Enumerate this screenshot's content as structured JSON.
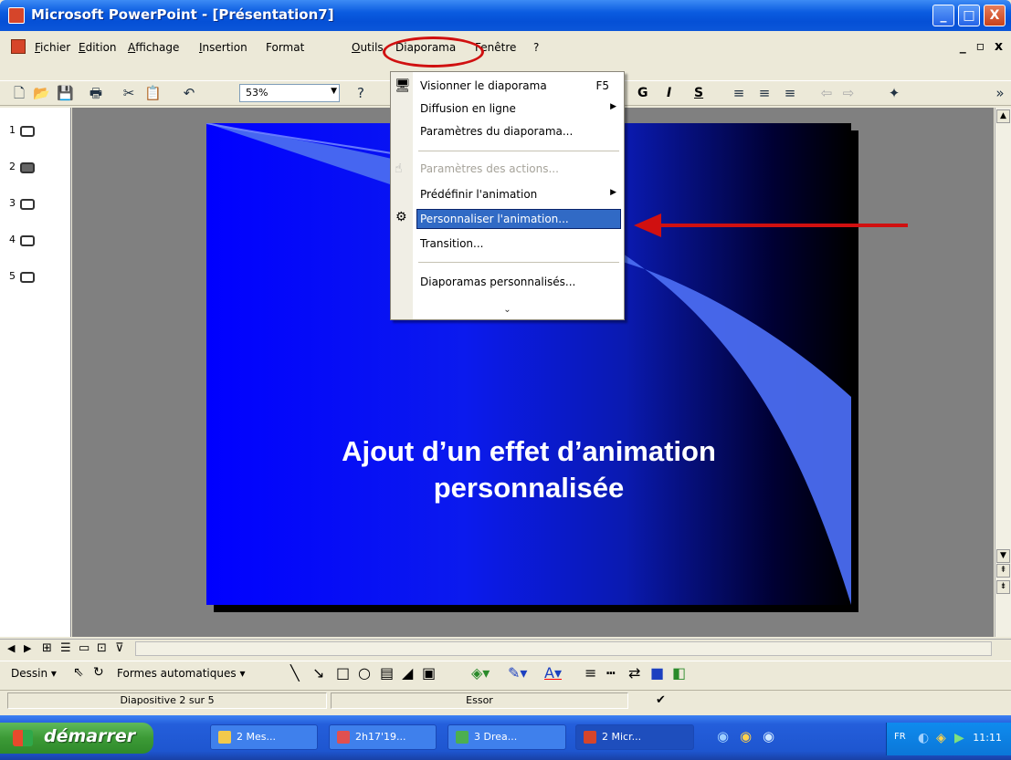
{
  "window": {
    "title": "Microsoft PowerPoint - [Présentation7]",
    "buttons": [
      "_",
      "□",
      "X"
    ]
  },
  "menubar": {
    "items": [
      "Fichier",
      "Edition",
      "Affichage",
      "Insertion",
      "Format",
      "Outils",
      "Diaporama",
      "Fenêtre",
      "?"
    ],
    "mdi_controls": "_ ▫ x"
  },
  "toolbar": {
    "zoom": "53%",
    "format_buttons": [
      "G",
      "I",
      "S"
    ]
  },
  "dropdown": {
    "menu": "Diaporama",
    "items": [
      {
        "label": "Visionner le diaporama",
        "shortcut": "F5",
        "icon": "slideshow-icon"
      },
      {
        "label": "Diffusion en ligne",
        "submenu": true
      },
      {
        "label": "Paramètres du diaporama..."
      },
      {
        "label": "Paramètres des actions...",
        "disabled": true,
        "icon": "action-icon"
      },
      {
        "label": "Prédéfinir l'animation",
        "submenu": true
      },
      {
        "label": "Personnaliser l'animation...",
        "highlighted": true,
        "icon": "custom-animation-icon"
      },
      {
        "label": "Transition..."
      },
      {
        "label": "Diaporamas personnalisés..."
      }
    ],
    "more": "⌄"
  },
  "outline": {
    "slides": [
      "1",
      "2",
      "3",
      "4",
      "5"
    ],
    "selected": "2"
  },
  "slide": {
    "title_line1": "Ajout d’un effet d’animation",
    "title_line2": "personnalisée"
  },
  "drawbar": {
    "dessin": "Dessin",
    "formes": "Formes automatiques"
  },
  "status": {
    "slide_info": "Diapositive 2 sur 5",
    "design": "Essor"
  },
  "taskbar": {
    "start": "démarrer",
    "tasks": [
      {
        "label": "2 Mes..."
      },
      {
        "label": "2h17'19..."
      },
      {
        "label": "3 Drea..."
      },
      {
        "label": "2 Micr..."
      }
    ],
    "lang": "FR",
    "clock": "11:11"
  },
  "colors": {
    "xp_blue": "#0550d6",
    "highlight": "#316ac5",
    "annotation_red": "#d01010"
  }
}
